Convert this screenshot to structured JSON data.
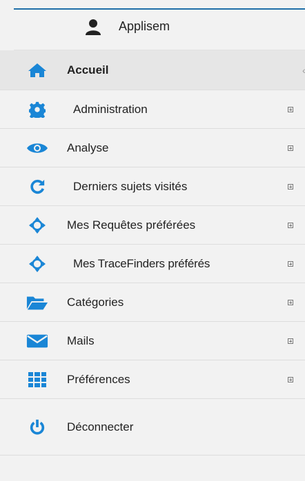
{
  "user": {
    "name": "Applisem",
    "icon": "user-icon"
  },
  "menu": {
    "items": [
      {
        "label": "Accueil",
        "icon": "home-icon",
        "active": true
      },
      {
        "label": "Administration",
        "icon": "gear-icon",
        "expandable": true
      },
      {
        "label": "Analyse",
        "icon": "eye-icon",
        "expandable": true
      },
      {
        "label": "Derniers sujets visités",
        "icon": "refresh-icon",
        "expandable": true
      },
      {
        "label": "Mes Requêtes préférées",
        "icon": "crosshair-icon",
        "expandable": true
      },
      {
        "label": "Mes TraceFinders préférés",
        "icon": "crosshair-icon",
        "expandable": true
      },
      {
        "label": "Catégories",
        "icon": "folder-open-icon",
        "expandable": true
      },
      {
        "label": "Mails",
        "icon": "envelope-icon",
        "expandable": true
      },
      {
        "label": "Préférences",
        "icon": "grid-icon",
        "expandable": true
      },
      {
        "label": "Déconnecter",
        "icon": "power-icon"
      }
    ]
  },
  "colors": {
    "accent": "#1a86d6",
    "topline": "#1f6fa8",
    "active_bg": "#e6e6e6",
    "bg": "#f2f2f2"
  }
}
